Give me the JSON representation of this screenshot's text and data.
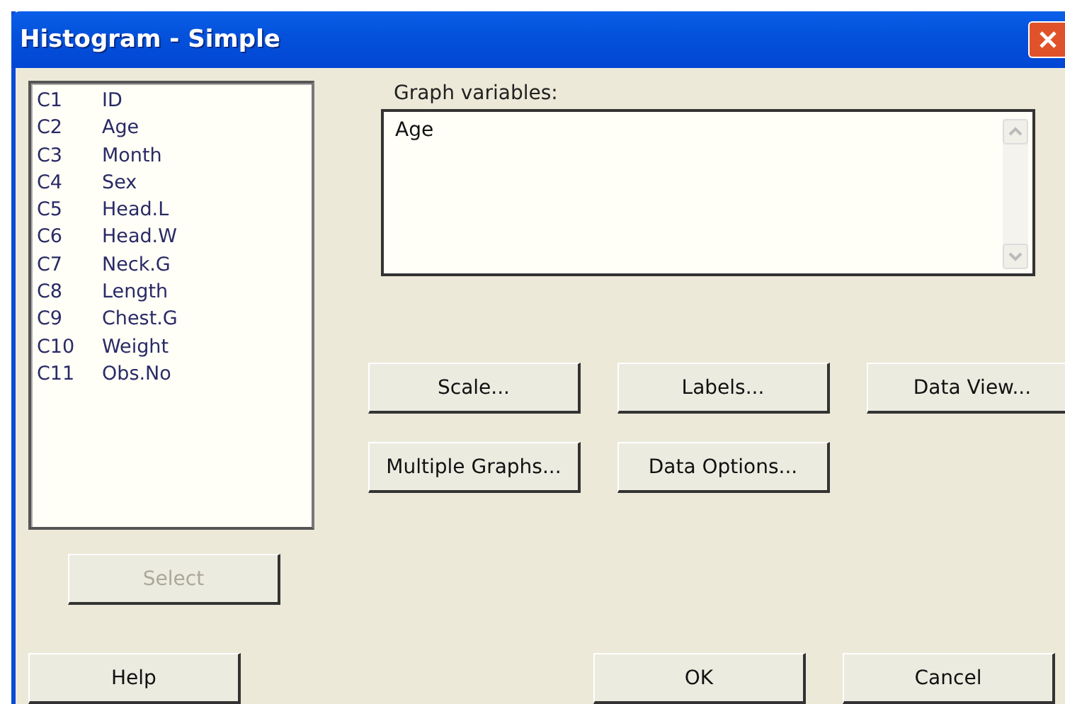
{
  "window": {
    "title": "Histogram - Simple"
  },
  "variables": [
    {
      "column": "C1",
      "name": "ID"
    },
    {
      "column": "C2",
      "name": "Age"
    },
    {
      "column": "C3",
      "name": "Month"
    },
    {
      "column": "C4",
      "name": "Sex"
    },
    {
      "column": "C5",
      "name": "Head.L"
    },
    {
      "column": "C6",
      "name": "Head.W"
    },
    {
      "column": "C7",
      "name": "Neck.G"
    },
    {
      "column": "C8",
      "name": "Length"
    },
    {
      "column": "C9",
      "name": "Chest.G"
    },
    {
      "column": "C10",
      "name": "Weight"
    },
    {
      "column": "C11",
      "name": "Obs.No"
    }
  ],
  "graph_variables": {
    "label": "Graph variables:",
    "value": "Age"
  },
  "option_buttons": [
    {
      "label": "Scale..."
    },
    {
      "label": "Labels..."
    },
    {
      "label": "Data View..."
    },
    {
      "label": "Multiple Graphs..."
    },
    {
      "label": "Data Options..."
    }
  ],
  "select_button": {
    "label": "Select",
    "disabled": true
  },
  "buttons": [
    {
      "label": "Help"
    },
    {
      "label": "OK"
    },
    {
      "label": "Cancel"
    }
  ]
}
